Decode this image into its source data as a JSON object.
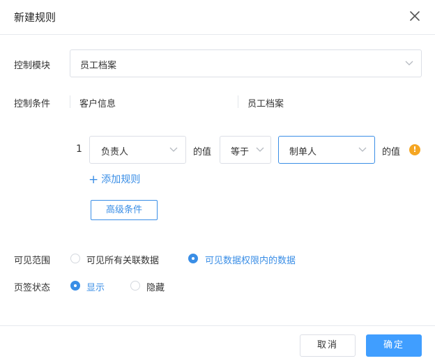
{
  "dialog": {
    "title": "新建规则"
  },
  "control_module": {
    "label": "控制模块",
    "value": "员工档案"
  },
  "control_condition": {
    "label": "控制条件",
    "left_column": "客户信息",
    "right_column": "员工档案"
  },
  "rule": {
    "index": "1",
    "left_field": "负责人",
    "of_value_1": "的值",
    "operator": "等于",
    "right_field": "制单人",
    "of_value_2": "的值",
    "warning_glyph": "!"
  },
  "add_rule": {
    "plus": "+",
    "label": "添加规则"
  },
  "advanced": {
    "label": "高级条件"
  },
  "visibility": {
    "label": "可见范围",
    "options": [
      {
        "label": "可见所有关联数据",
        "checked": false
      },
      {
        "label": "可见数据权限内的数据",
        "checked": true
      }
    ]
  },
  "tab_status": {
    "label": "页签状态",
    "options": [
      {
        "label": "显示",
        "checked": true
      },
      {
        "label": "隐藏",
        "checked": false
      }
    ]
  },
  "footer": {
    "cancel": "取消",
    "ok": "确定"
  },
  "colors": {
    "accent": "#3a8ee6",
    "primary_button": "#409eff",
    "warning": "#f5a623"
  },
  "icons": {
    "close": "close-icon",
    "dropdown": "chevron-down-icon",
    "warning": "warning-icon",
    "plus": "plus-icon"
  }
}
